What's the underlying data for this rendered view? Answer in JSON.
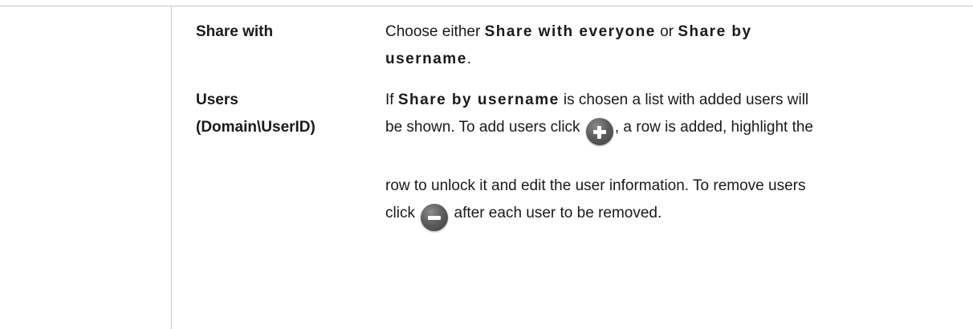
{
  "rows": [
    {
      "term": "Share with",
      "def": {
        "l1_pre": "Choose either ",
        "l1_ui1": "Share with everyone",
        "l1_mid": " or ",
        "l1_ui2a": "Share by",
        "l2_ui2b": "username",
        "l2_post": "."
      }
    },
    {
      "term_line1": "Users",
      "term_line2": "(Domain\\UserID)",
      "def": {
        "l1_pre": "If ",
        "l1_ui": "Share by username",
        "l1_post": " is chosen a list with added users will",
        "l2_pre": "be shown. To add users click ",
        "l2_post": ", a row is added, highlight the",
        "l3": "row to unlock it and edit the user information. To remove users",
        "l4_pre": "click ",
        "l4_post": " after each user to be removed."
      }
    }
  ],
  "icons": {
    "add": "add-plus-icon",
    "remove": "remove-minus-icon"
  }
}
